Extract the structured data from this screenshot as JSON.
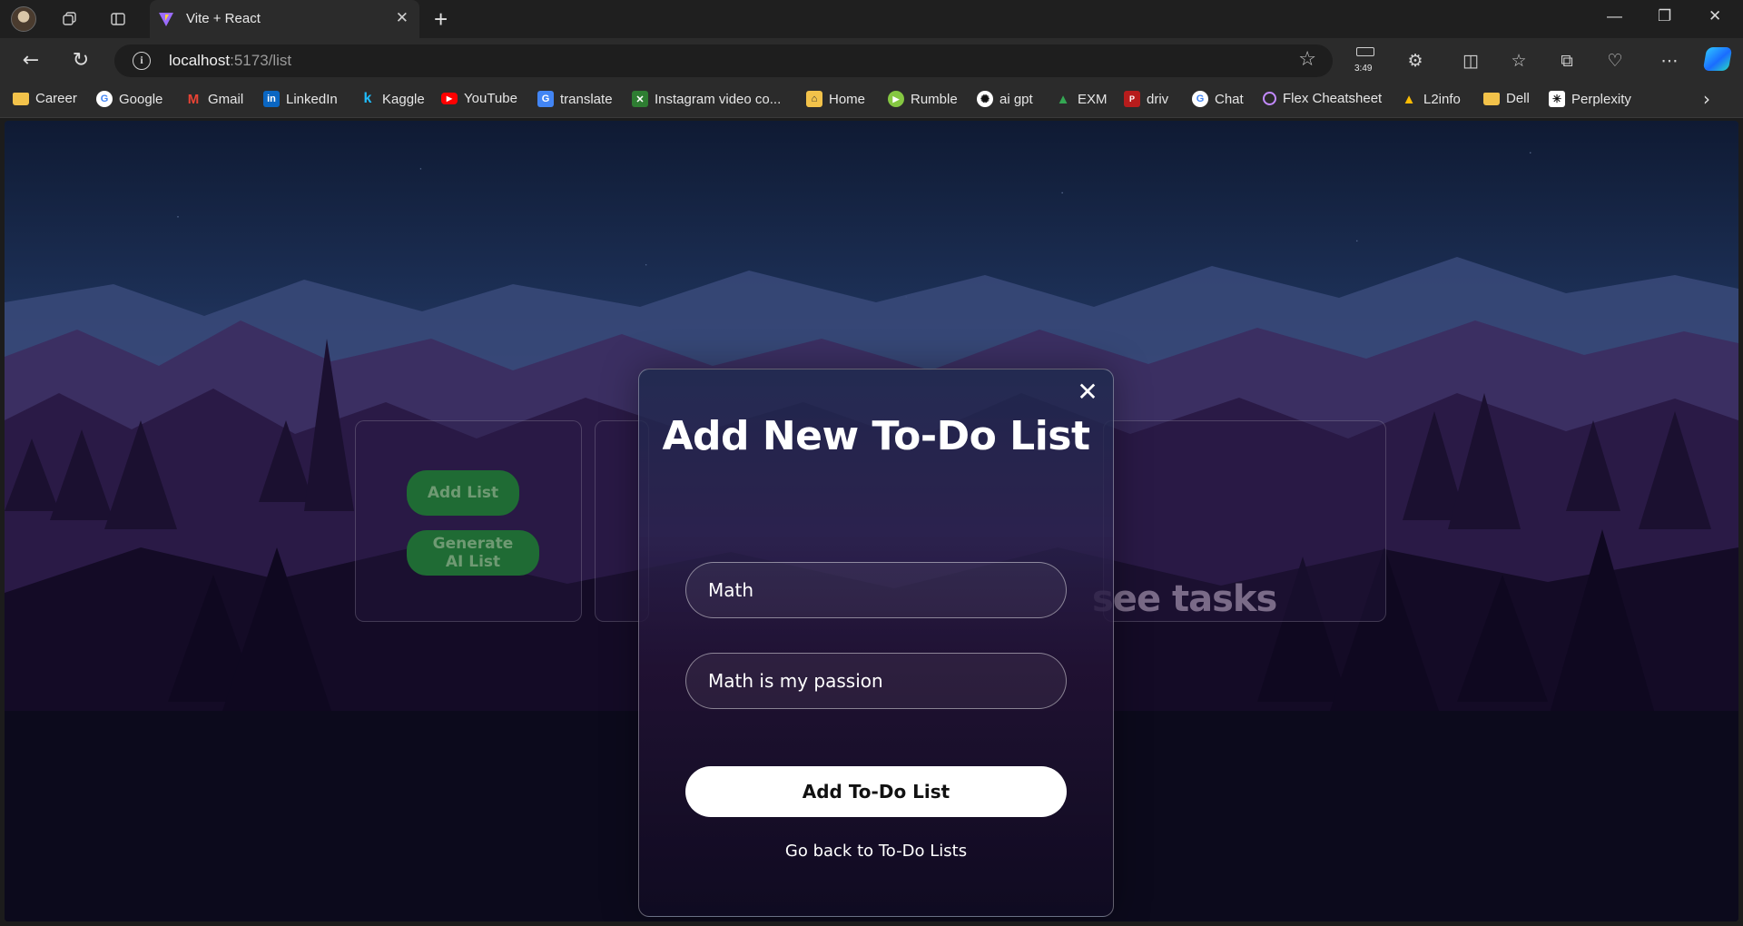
{
  "browser": {
    "tab_title": "Vite + React",
    "url_host": "localhost",
    "url_rest": ":5173/list",
    "battery_time": "3:49"
  },
  "bookmarks": [
    {
      "label": "Career",
      "icon": "folder-icon"
    },
    {
      "label": "Google",
      "icon": "google-icon"
    },
    {
      "label": "Gmail",
      "icon": "gmail-icon"
    },
    {
      "label": "LinkedIn",
      "icon": "linkedin-icon"
    },
    {
      "label": "Kaggle",
      "icon": "kaggle-icon"
    },
    {
      "label": "YouTube",
      "icon": "youtube-icon"
    },
    {
      "label": "translate",
      "icon": "translate-icon"
    },
    {
      "label": "Instagram video co...",
      "icon": "instagram-video-icon"
    },
    {
      "label": "Home",
      "icon": "home-icon"
    },
    {
      "label": "Rumble",
      "icon": "rumble-icon"
    },
    {
      "label": "ai gpt",
      "icon": "openai-icon"
    },
    {
      "label": "EXM",
      "icon": "drive-icon"
    },
    {
      "label": "driv",
      "icon": "driv-icon"
    },
    {
      "label": "Chat",
      "icon": "google-icon"
    },
    {
      "label": "Flex Cheatsheet",
      "icon": "circle-icon"
    },
    {
      "label": "L2info",
      "icon": "drive-icon"
    },
    {
      "label": "Dell",
      "icon": "folder-icon"
    },
    {
      "label": "Perplexity",
      "icon": "perplexity-icon"
    }
  ],
  "background_page": {
    "add_list_label": "Add List",
    "generate_label": "Generate AI List",
    "ghost_text": "see tasks"
  },
  "modal": {
    "title": "Add New To-Do List",
    "name_value": "Math",
    "description_value": "Math is my passion",
    "submit_label": "Add To-Do List",
    "back_label": "Go back to To-Do Lists",
    "close_glyph": "✕"
  },
  "colors": {
    "accent_green": "#1f6b34",
    "primary_button_bg": "#ffffff"
  }
}
